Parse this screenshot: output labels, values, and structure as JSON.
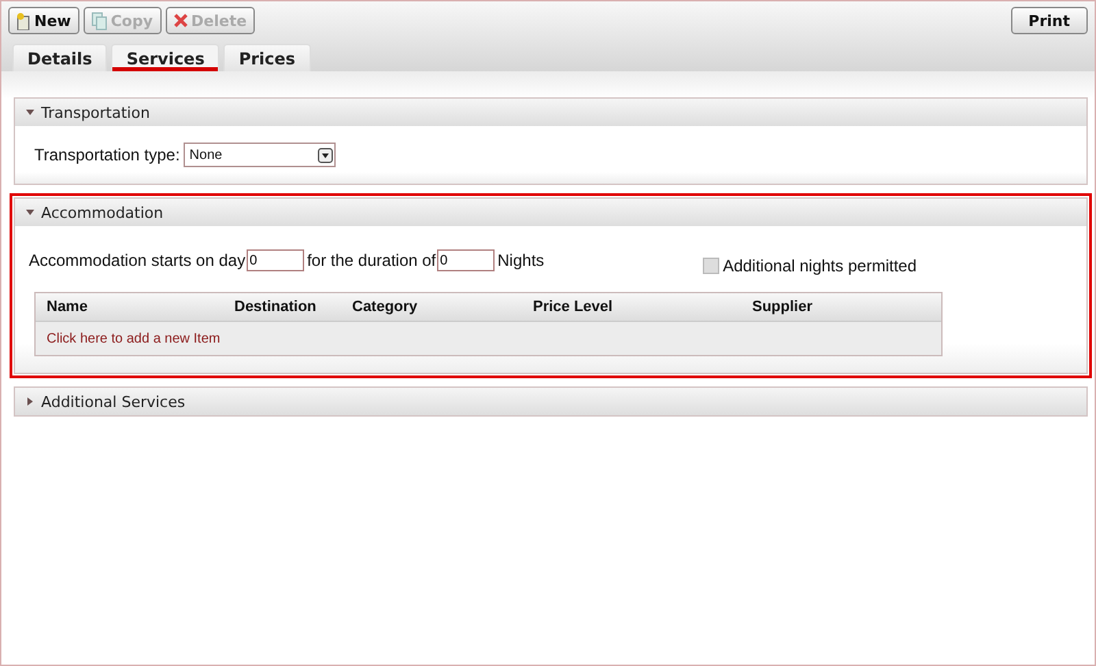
{
  "toolbar": {
    "buttons": [
      {
        "label": "New",
        "kind": "new",
        "disabled": false
      },
      {
        "label": "Copy",
        "kind": "copy",
        "disabled": true
      },
      {
        "label": "Delete",
        "kind": "delete",
        "disabled": true
      }
    ],
    "print": "Print"
  },
  "tabs": [
    {
      "label": "Details",
      "selected": false
    },
    {
      "label": "Services",
      "selected": true
    },
    {
      "label": "Prices",
      "selected": false
    }
  ],
  "sections": [
    {
      "kind": "transportation",
      "title": "Transportation",
      "expanded": true,
      "highlighted": false,
      "type_label": "Transportation type:",
      "type_value": "None"
    },
    {
      "kind": "accommodation",
      "title": "Accommodation",
      "expanded": true,
      "highlighted": true,
      "starts_label": "Accommodation starts on day",
      "start_day": "0",
      "duration_label": "for the duration of",
      "nights": "0",
      "nights_label": "Nights",
      "additional_label": "Additional nights permitted",
      "additional_checked": false,
      "additional_disabled": true,
      "columns": [
        "Name",
        "Destination",
        "Category",
        "Price Level",
        "Supplier"
      ],
      "add_item": "Click here to add a new Item"
    },
    {
      "title": "Additional Services",
      "expanded": false,
      "highlighted": false
    }
  ]
}
